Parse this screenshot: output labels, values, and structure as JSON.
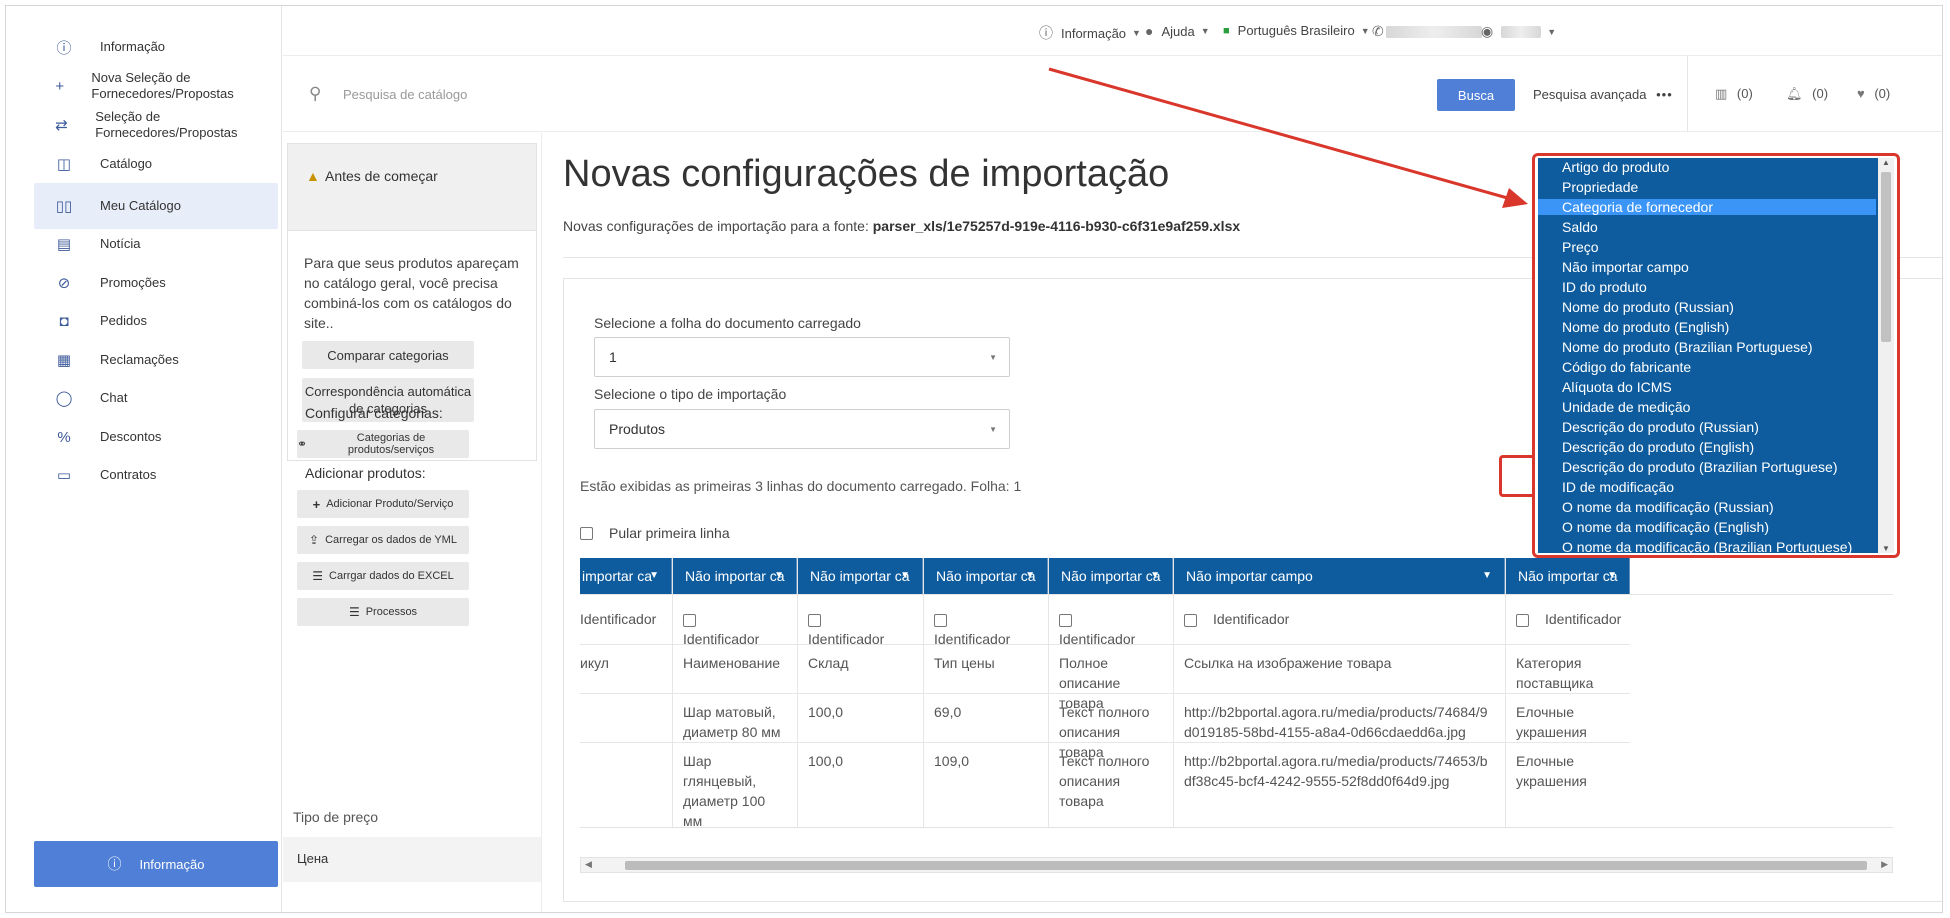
{
  "sidebar": {
    "items": [
      {
        "label": "Informação",
        "icon": "info-icon"
      },
      {
        "label": "Nova Seleção de Fornecedores/Propostas",
        "icon": "plus-icon"
      },
      {
        "label": "Seleção de Fornecedores/Propostas",
        "icon": "exchange-icon"
      },
      {
        "label": "Catálogo",
        "icon": "catalog-icon"
      },
      {
        "label": "Meu Catálogo",
        "icon": "book-icon"
      },
      {
        "label": "Notícia",
        "icon": "news-icon"
      },
      {
        "label": "Promoções",
        "icon": "percent-badge-icon"
      },
      {
        "label": "Pedidos",
        "icon": "orders-icon"
      },
      {
        "label": "Reclamações",
        "icon": "complaints-icon"
      },
      {
        "label": "Chat",
        "icon": "chat-icon"
      },
      {
        "label": "Descontos",
        "icon": "percent-icon"
      },
      {
        "label": "Contratos",
        "icon": "document-icon"
      }
    ],
    "bottom_button": "Informação"
  },
  "topbar": {
    "info": "Informação",
    "help": "Ajuda",
    "language": "Português Brasileiro"
  },
  "search": {
    "placeholder": "Pesquisa de catálogo",
    "button": "Busca",
    "advanced": "Pesquisa avançada",
    "compare_count": "(0)",
    "notifications_count": "(0)",
    "favorites_count": "(0)"
  },
  "left_panel": {
    "before_title": "Antes de começar",
    "info_text": "Para que seus produtos apareçam no catálogo geral, você precisa combiná-los com os catálogos do site..",
    "compare_btn": "Comparar categorias",
    "auto_match_btn": "Correspondência automática de categorias",
    "configure_label": "Configurar categorias:",
    "categories_btn": "Categorias de produtos/serviços",
    "add_products_label": "Adicionar produtos:",
    "add_product_btn": "Adicionar Produto/Serviço",
    "yml_btn": "Carregar os dados de YML",
    "excel_btn": "Carrgar dados do EXCEL",
    "processes_btn": "Processos",
    "price_type_label": "Tipo de preço",
    "price_value": "Цена"
  },
  "main": {
    "title": "Novas configurações de importação",
    "subtitle_prefix": "Novas configurações de importação para a fonte:",
    "subtitle_file": "parser_xls/1e75257d-919e-4116-b930-c6f31e9af259.xlsx",
    "sheet_label": "Selecione a folha do documento carregado",
    "sheet_value": "1",
    "import_type_label": "Selecione o tipo de importação",
    "import_type_value": "Produtos",
    "note": "Estão exibidas as primeiras 3 linhas do documento carregado. Folha: 1",
    "skip_first_row": "Pular primeira linha"
  },
  "table": {
    "columns": [
      {
        "header": "importar ca",
        "checkbox_label": "Identificador",
        "rows": [
          "икул",
          "",
          ""
        ]
      },
      {
        "header": "Não importar ca",
        "checkbox_label": "Identificador",
        "rows": [
          "Наименование",
          "Шар матовый, диаметр 80 мм",
          "Шар глянцевый, диаметр 100 мм"
        ]
      },
      {
        "header": "Não importar ca",
        "checkbox_label": "Identificador",
        "rows": [
          "Склад",
          "100,0",
          "100,0"
        ]
      },
      {
        "header": "Não importar ca",
        "checkbox_label": "Identificador",
        "rows": [
          "Тип цены",
          "69,0",
          "109,0"
        ]
      },
      {
        "header": "Não importar ca",
        "checkbox_label": "Identificador",
        "rows": [
          "Полное описание товара",
          "Текст полного описания товара",
          "Текст полного описания товара"
        ]
      },
      {
        "header": "Não importar campo",
        "checkbox_label": "Identificador",
        "rows": [
          "Ссылка на изображение товара",
          "http://b2bportal.agora.ru/media/products/74684/9d019185-58bd-4155-a8a4-0d66cdaedd6a.jpg",
          "http://b2bportal.agora.ru/media/products/74653/bdf38c45-bcf4-4242-9555-52f8dd0f64d9.jpg"
        ]
      },
      {
        "header": "Não importar ca",
        "checkbox_label": "Identificador",
        "rows": [
          "Категория поставщика",
          "Елочные украшения",
          "Елочные украшения"
        ]
      }
    ]
  },
  "dropdown": {
    "selected_index": 2,
    "options": [
      "Artigo do produto",
      "Propriedade",
      "Categoria de fornecedor",
      "Saldo",
      "Preço",
      "Não importar campo",
      "ID do produto",
      "Nome do produto (Russian)",
      "Nome do produto (English)",
      "Nome do produto (Brazilian Portuguese)",
      "Código do fabricante",
      "Alíquota do ICMS",
      "Unidade de medição",
      "Descrição do produto (Russian)",
      "Descrição do produto (English)",
      "Descrição do produto (Brazilian Portuguese)",
      "ID de modificação",
      "O nome da modificação (Russian)",
      "O nome da modificação (English)",
      "O nome da modificação (Brazilian Portuguese)"
    ]
  },
  "colors": {
    "accent": "#4f7fd6",
    "table_header": "#0e5c9e",
    "dropdown_selected": "#3b95f7",
    "annotation": "#d9372b",
    "sidebar_active": "#e8eef9"
  }
}
